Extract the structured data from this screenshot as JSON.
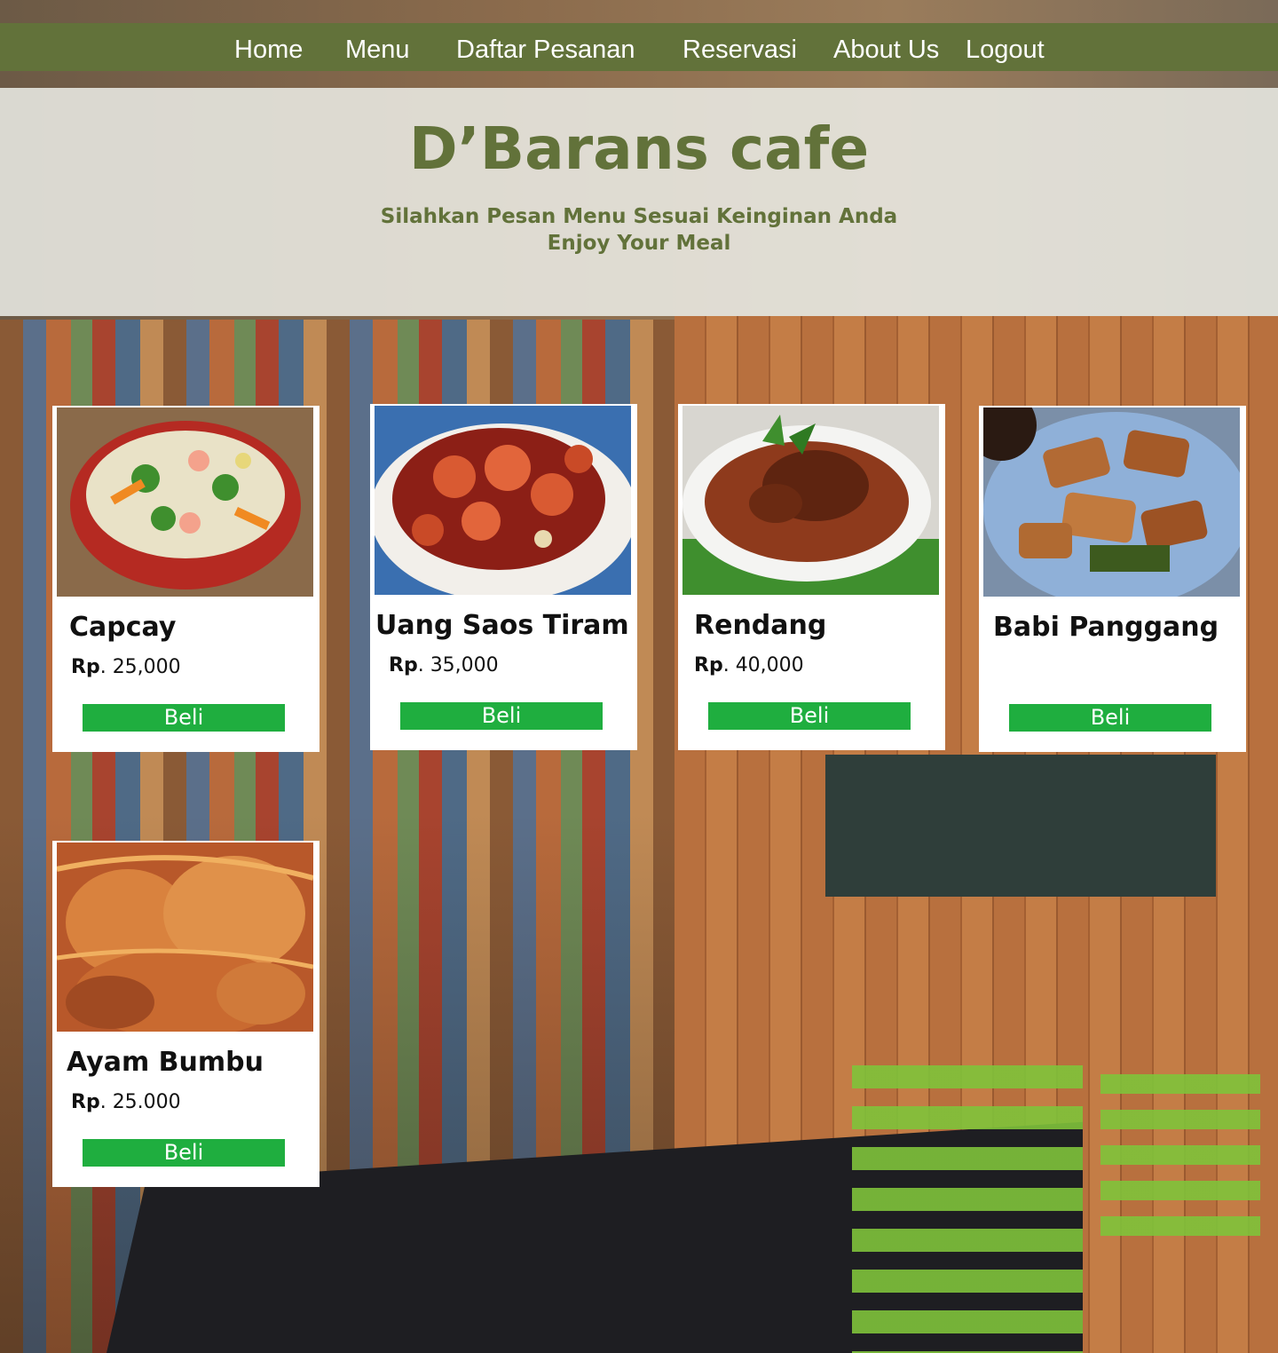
{
  "nav": {
    "home": "Home",
    "menu": "Menu",
    "daftar_pesanan": "Daftar Pesanan",
    "reservasi": "Reservasi",
    "about_us": "About Us",
    "logout": "Logout"
  },
  "hero": {
    "title": "D’Barans cafe",
    "subtitle_1": "Silahkan Pesan Menu Sesuai Keinginan Anda",
    "subtitle_2": "Enjoy Your Meal"
  },
  "colors": {
    "nav_bg": "#62723a",
    "brand_green": "#62723a",
    "buy_button": "#1fae3f"
  },
  "menu_items": [
    {
      "name": "Capcay",
      "currency": "Rp",
      "price": ". 25,000",
      "button": "Beli"
    },
    {
      "name": "Uang Saos Tiram",
      "currency": "Rp",
      "price": ". 35,000",
      "button": "Beli"
    },
    {
      "name": "Rendang",
      "currency": "Rp",
      "price": ". 40,000",
      "button": "Beli"
    },
    {
      "name": "Babi Panggang",
      "button": "Beli"
    },
    {
      "name": "Ayam Bumbu",
      "currency": "Rp",
      "price": ". 25.000",
      "button": "Beli"
    }
  ]
}
